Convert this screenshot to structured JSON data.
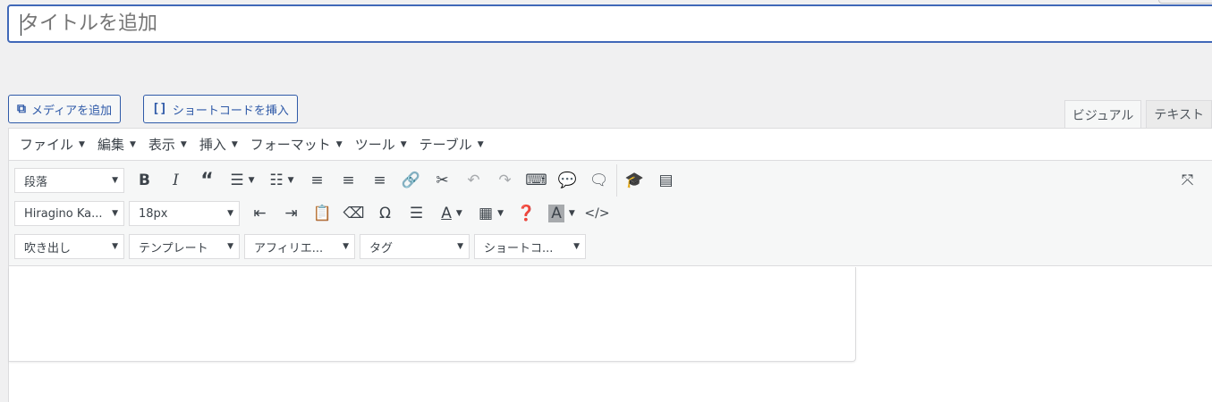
{
  "title_field": {
    "placeholder": "タイトルを追加"
  },
  "media_buttons": {
    "add_media": "メディアを追加",
    "insert_shortcode": "ショートコードを挿入"
  },
  "editor_tabs": {
    "visual": "ビジュアル",
    "text": "テキスト"
  },
  "menubar": [
    "ファイル",
    "編集",
    "表示",
    "挿入",
    "フォーマット",
    "ツール",
    "テーブル"
  ],
  "toolbar": {
    "paragraph_select": "段落",
    "font_family_select": "Hiragino Ka...",
    "font_size_select": "18px",
    "balloon_select": "吹き出し",
    "template_select": "テンプレート",
    "affiliate_select": "アフィリエ...",
    "tag_select": "タグ",
    "shortcode_select": "ショートコ...",
    "bold_glyph": "B",
    "italic_glyph": "I",
    "omega_glyph": "Ω",
    "text_color_glyph": "A",
    "bg_color_glyph": "A"
  },
  "colors": {
    "accent": "#2f5aa8",
    "title_border": "#4068b8",
    "bg": "#f0f0f1"
  }
}
